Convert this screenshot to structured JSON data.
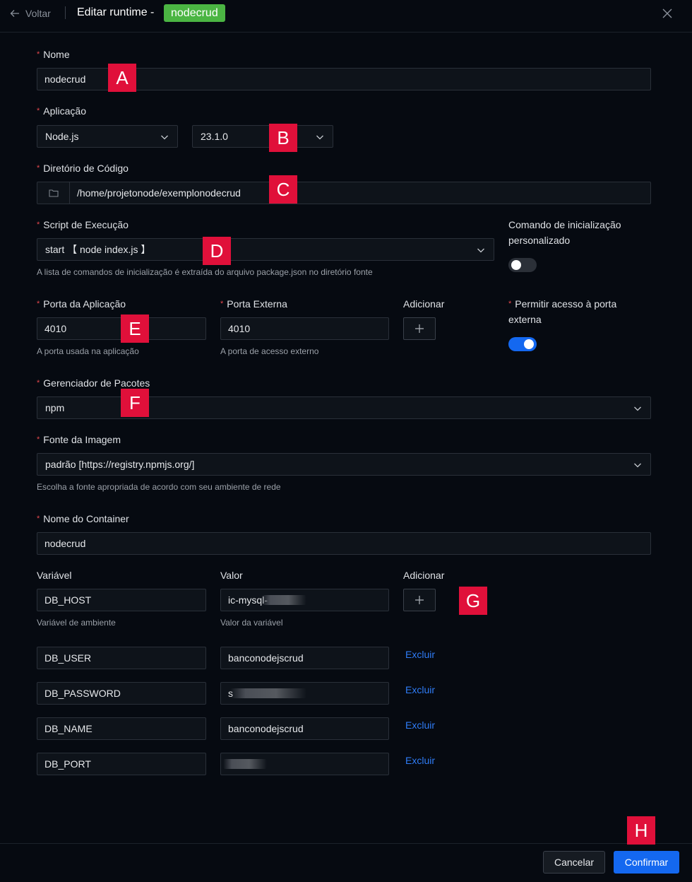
{
  "header": {
    "back_label": "Voltar",
    "title": "Editar runtime -",
    "tag": "nodecrud"
  },
  "form": {
    "name": {
      "label": "Nome",
      "value": "nodecrud"
    },
    "application": {
      "label": "Aplicação",
      "runtime": "Node.js",
      "version": "23.1.0"
    },
    "code_dir": {
      "label": "Diretório de Código",
      "value": "/home/projetonode/exemplonodecrud"
    },
    "exec_script": {
      "label": "Script de Execução",
      "value": "start 【 node index.js 】",
      "help": "A lista de comandos de inicialização é extraída do arquivo package.json no diretório fonte"
    },
    "custom_cmd": {
      "label_line1": "Comando de inicialização",
      "label_line2": "personalizado",
      "enabled": false
    },
    "app_port": {
      "label": "Porta da Aplicação",
      "value": "4010",
      "help": "A porta usada na aplicação"
    },
    "ext_port": {
      "label": "Porta Externa",
      "value": "4010",
      "help": "A porta de acesso externo"
    },
    "port_add_label": "Adicionar",
    "allow_ext": {
      "label_line1": "Permitir acesso à porta",
      "label_line2": "externa",
      "enabled": true
    },
    "pkg_manager": {
      "label": "Gerenciador de Pacotes",
      "value": "npm"
    },
    "image_source": {
      "label": "Fonte da Imagem",
      "value": "padrão [https://registry.npmjs.org/]",
      "help": "Escolha a fonte apropriada de acordo com seu ambiente de rede"
    },
    "container_name": {
      "label": "Nome do Container",
      "value": "nodecrud"
    }
  },
  "env": {
    "var_header": "Variável",
    "value_header": "Valor",
    "add_header": "Adicionar",
    "var_help": "Variável de ambiente",
    "value_help": "Valor da variável",
    "delete_label": "Excluir",
    "rows": [
      {
        "name": "DB_HOST",
        "value": "ic-mysql-"
      },
      {
        "name": "DB_USER",
        "value": "banconodejscrud"
      },
      {
        "name": "DB_PASSWORD",
        "value": "s"
      },
      {
        "name": "DB_NAME",
        "value": "banconodejscrud"
      },
      {
        "name": "DB_PORT",
        "value": ""
      }
    ]
  },
  "footer": {
    "cancel_label": "Cancelar",
    "confirm_label": "Confirmar"
  },
  "markers": [
    "A",
    "B",
    "C",
    "D",
    "E",
    "F",
    "G",
    "H"
  ],
  "colors": {
    "background": "#060a11",
    "accent": "#1468f0",
    "tag": "#4bb543",
    "marker": "#e0103a",
    "required": "#e5484d",
    "link": "#2f7cf6"
  },
  "icons": {
    "back": "arrow-left-icon",
    "close": "close-icon",
    "folder": "folder-icon",
    "chevron": "chevron-down-icon",
    "add": "plus-icon"
  }
}
